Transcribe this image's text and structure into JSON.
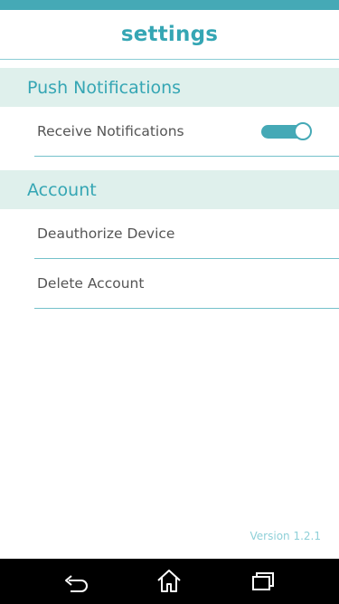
{
  "header": {
    "title": "settings"
  },
  "sections": [
    {
      "title": "Push Notifications",
      "rows": [
        {
          "label": "Receive Notifications",
          "toggle_on": true
        }
      ]
    },
    {
      "title": "Account",
      "rows": [
        {
          "label": "Deauthorize Device"
        },
        {
          "label": "Delete Account"
        }
      ]
    }
  ],
  "footer": {
    "version": "Version 1.2.1"
  },
  "navbar": {
    "icons": [
      "back-icon",
      "home-icon",
      "recent-apps-icon"
    ]
  },
  "colors": {
    "accent": "#45a9b6",
    "section_bg": "#dff0ec",
    "row_text": "#555555",
    "navbar_bg": "#000000"
  }
}
